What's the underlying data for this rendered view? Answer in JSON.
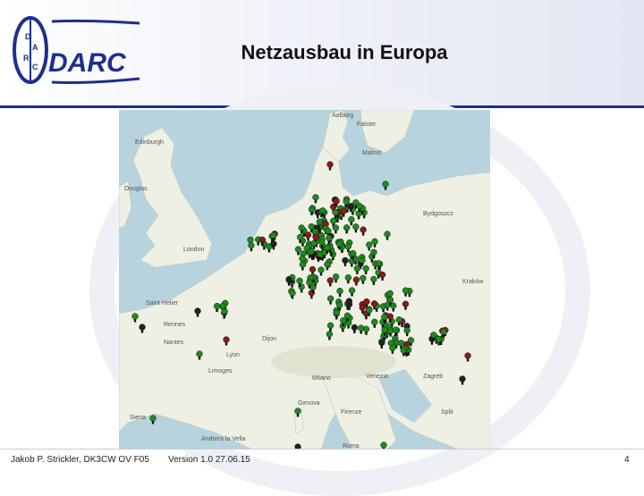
{
  "slide": {
    "title": "Netzausbau in Europa",
    "logo_text": "DARC",
    "logo_ring_text": "DARC",
    "footer": {
      "author": "Jakob P. Strickler, DK3CW OV F05",
      "version": "Version 1.0 27.06.15",
      "page": "4"
    }
  },
  "map": {
    "labels": [
      "Aalborg",
      "Falster",
      "Malmö",
      "Edinburgh",
      "Douglas",
      "London",
      "Bydgoszcz",
      "Kraków",
      "Saint Helier",
      "Rennes",
      "Nantes",
      "Dijon",
      "Limoges",
      "Milano",
      "Venezia",
      "Genova",
      "Firenze",
      "Zagreb",
      "Split",
      "Roma",
      "Andorra la Vella",
      "Siena",
      "Lyon"
    ],
    "marker_colors": {
      "active": "#1e8a1e",
      "planned": "#8b1a1a",
      "other": "#222222"
    }
  }
}
